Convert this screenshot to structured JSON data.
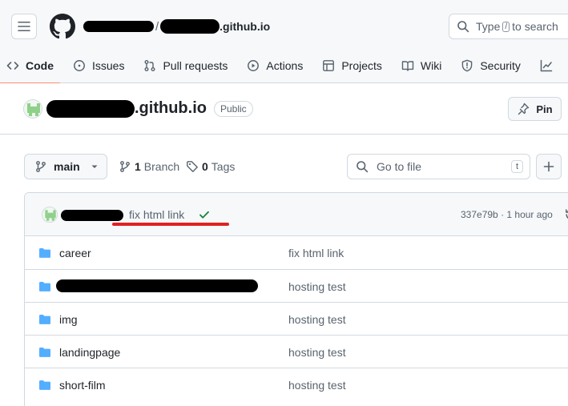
{
  "header": {
    "repo_crumb": ".github.io",
    "search": {
      "prefix": "Type",
      "key": "/",
      "suffix": "to search"
    }
  },
  "nav": {
    "tabs": [
      {
        "label": "Code",
        "icon": "code-icon",
        "active": true
      },
      {
        "label": "Issues",
        "icon": "issue-icon",
        "active": false
      },
      {
        "label": "Pull requests",
        "icon": "pull-request-icon",
        "active": false
      },
      {
        "label": "Actions",
        "icon": "play-icon",
        "active": false
      },
      {
        "label": "Projects",
        "icon": "table-icon",
        "active": false
      },
      {
        "label": "Wiki",
        "icon": "book-icon",
        "active": false
      },
      {
        "label": "Security",
        "icon": "shield-icon",
        "active": false
      }
    ]
  },
  "repo": {
    "name_suffix": ".github.io",
    "visibility": "Public",
    "pin_label": "Pin"
  },
  "branchbar": {
    "branch": "main",
    "branch_count": "1",
    "branch_word": "Branch",
    "tag_count": "0",
    "tag_word": "Tags",
    "goto_placeholder": "Go to file",
    "goto_key": "t"
  },
  "commit": {
    "message": "fix html link",
    "hash": "337e79b",
    "separator": "·",
    "time": "1 hour ago",
    "status_color": "#1a7f37",
    "annotation_color": "#e02020"
  },
  "files": [
    {
      "name": "career",
      "message": "fix html link"
    },
    {
      "name": "",
      "message": "hosting test"
    },
    {
      "name": "img",
      "message": "hosting test"
    },
    {
      "name": "landingpage",
      "message": "hosting test"
    },
    {
      "name": "short-film",
      "message": "hosting test"
    }
  ],
  "colors": {
    "folder": "#54aeff",
    "nav_active": "#fd8c73"
  }
}
